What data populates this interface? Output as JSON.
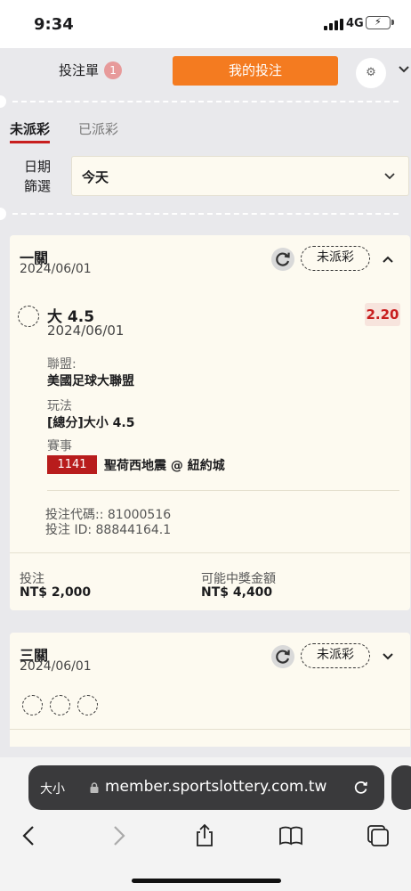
{
  "status_bar": {
    "time": "9:34",
    "network": "4G"
  },
  "header": {
    "bet_slip_label": "投注單",
    "bet_slip_count": "1",
    "my_bets_label": "我的投注"
  },
  "filter": {
    "tabs": [
      "未派彩",
      "已派彩"
    ],
    "active_tab": "未派彩",
    "date_label": "日期篩選",
    "date_value": "今天"
  },
  "bets": [
    {
      "type": "一關",
      "date": "2024/06/01",
      "status": "未派彩",
      "selection": {
        "name": "大 4.5",
        "date": "2024/06/01",
        "odds": "2.20",
        "league_label": "聯盟:",
        "league": "美國足球大聯盟",
        "market_label": "玩法",
        "market": "[總分]大小 4.5",
        "event_label": "賽事",
        "event_code": "1141",
        "event_name": "聖荷西地震 @ 紐約城"
      },
      "bet_code": "投注代碼:: 81000516",
      "bet_id": "投注 ID: 88844164.1",
      "stake_label": "投注",
      "stake": "NT$ 2,000",
      "payout_label": "可能中獎金額",
      "payout": "NT$ 4,400"
    },
    {
      "type": "三關",
      "date": "2024/06/01",
      "status": "未派彩"
    }
  ],
  "browser": {
    "text_size_label": "大小",
    "url": "member.sportslottery.com.tw"
  },
  "colors": {
    "accent": "#f47b20",
    "tab_underline": "#c81e1e",
    "odds_text": "#c81e1e",
    "event_code_bg": "#b81c1c",
    "card_bg": "#fdfaf0",
    "page_bg": "#e9e9ec"
  }
}
